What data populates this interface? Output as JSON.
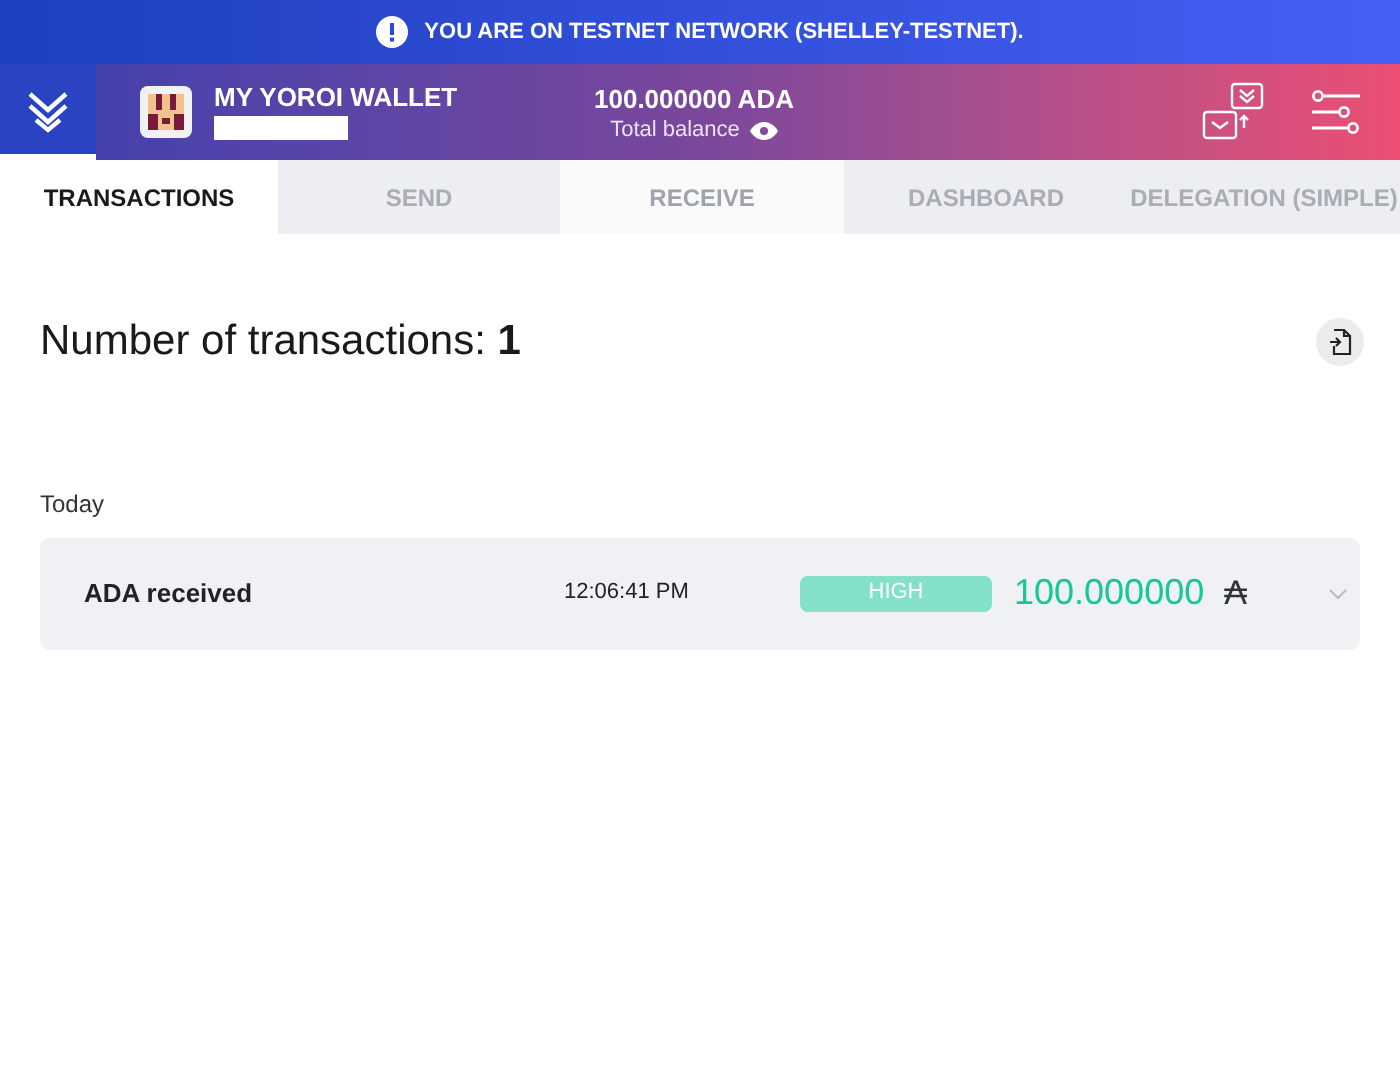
{
  "banner": {
    "text": "YOU ARE ON TESTNET NETWORK (SHELLEY-TESTNET)."
  },
  "header": {
    "wallet_name": "MY YOROI WALLET",
    "balance": "100.000000 ADA",
    "balance_label": "Total balance"
  },
  "tabs": [
    {
      "label": "TRANSACTIONS",
      "selected": true,
      "hovered": false
    },
    {
      "label": "SEND",
      "selected": false,
      "hovered": false
    },
    {
      "label": "RECEIVE",
      "selected": false,
      "hovered": true
    },
    {
      "label": "DASHBOARD",
      "selected": false,
      "hovered": false
    },
    {
      "label": "DELEGATION (SIMPLE)",
      "selected": false,
      "hovered": false
    }
  ],
  "summary": {
    "label": "Number of transactions:",
    "count": "1"
  },
  "groups": [
    {
      "date": "Today",
      "transactions": [
        {
          "type": "ADA received",
          "time": "12:06:41 PM",
          "level_badge": "HIGH",
          "amount": "100.000000",
          "currency_symbol": "₳",
          "expanded": false
        }
      ]
    }
  ]
}
